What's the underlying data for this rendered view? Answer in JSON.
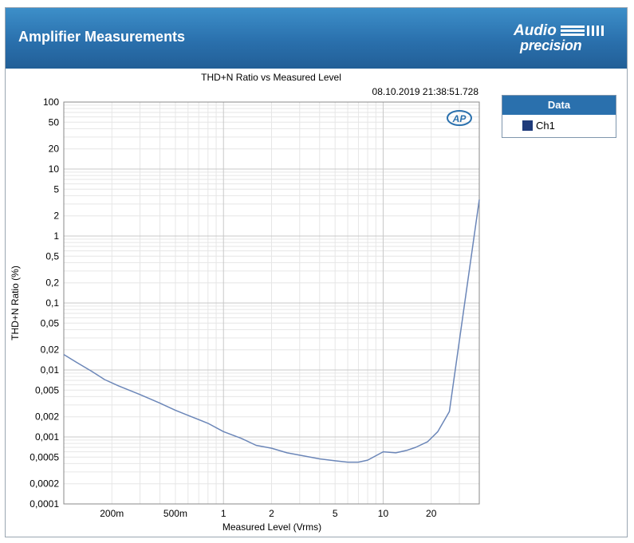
{
  "window": {
    "title": "Amplifier Measurements",
    "logo": {
      "line1": "Audio",
      "line2": "precision"
    }
  },
  "legend": {
    "header": "Data",
    "items": [
      {
        "label": "Ch1",
        "color": "#1f3b7a"
      }
    ]
  },
  "chart_data": {
    "type": "line",
    "title": "THD+N Ratio vs Measured Level",
    "timestamp": "08.10.2019 21:38:51.728",
    "xlabel": "Measured Level (Vrms)",
    "ylabel": "THD+N Ratio (%)",
    "x_scale": "log",
    "y_scale": "log",
    "xlim": [
      0.1,
      40
    ],
    "ylim": [
      0.0001,
      100
    ],
    "grid": true,
    "legend_position": "right",
    "x_ticks": [
      {
        "v": 0.2,
        "label": "200m"
      },
      {
        "v": 0.5,
        "label": "500m"
      },
      {
        "v": 1,
        "label": "1"
      },
      {
        "v": 2,
        "label": "2"
      },
      {
        "v": 5,
        "label": "5"
      },
      {
        "v": 10,
        "label": "10"
      },
      {
        "v": 20,
        "label": "20"
      }
    ],
    "y_ticks": [
      {
        "v": 100,
        "label": "100"
      },
      {
        "v": 50,
        "label": "50"
      },
      {
        "v": 20,
        "label": "20"
      },
      {
        "v": 10,
        "label": "10"
      },
      {
        "v": 5,
        "label": "5"
      },
      {
        "v": 2,
        "label": "2"
      },
      {
        "v": 1,
        "label": "1"
      },
      {
        "v": 0.5,
        "label": "0,5"
      },
      {
        "v": 0.2,
        "label": "0,2"
      },
      {
        "v": 0.1,
        "label": "0,1"
      },
      {
        "v": 0.05,
        "label": "0,05"
      },
      {
        "v": 0.02,
        "label": "0,02"
      },
      {
        "v": 0.01,
        "label": "0,01"
      },
      {
        "v": 0.005,
        "label": "0,005"
      },
      {
        "v": 0.002,
        "label": "0,002"
      },
      {
        "v": 0.001,
        "label": "0,001"
      },
      {
        "v": 0.0005,
        "label": "0,0005"
      },
      {
        "v": 0.0002,
        "label": "0,0002"
      },
      {
        "v": 0.0001,
        "label": "0,0001"
      }
    ],
    "series": [
      {
        "name": "Ch1",
        "color": "#6b86b8",
        "x": [
          0.1,
          0.12,
          0.15,
          0.18,
          0.22,
          0.3,
          0.4,
          0.5,
          0.6,
          0.8,
          1.0,
          1.3,
          1.6,
          2.0,
          2.5,
          3.2,
          4.0,
          5.0,
          6.0,
          7.0,
          8.0,
          10.0,
          12.0,
          14.0,
          16.0,
          19.0,
          22.0,
          26.0,
          40.0
        ],
        "y": [
          0.017,
          0.013,
          0.0095,
          0.0072,
          0.0058,
          0.0043,
          0.0032,
          0.0025,
          0.0021,
          0.0016,
          0.0012,
          0.00095,
          0.00075,
          0.00068,
          0.00058,
          0.00052,
          0.00047,
          0.00044,
          0.00042,
          0.00042,
          0.00045,
          0.0006,
          0.00058,
          0.00063,
          0.0007,
          0.00085,
          0.0012,
          0.0024,
          3.5
        ]
      }
    ]
  }
}
